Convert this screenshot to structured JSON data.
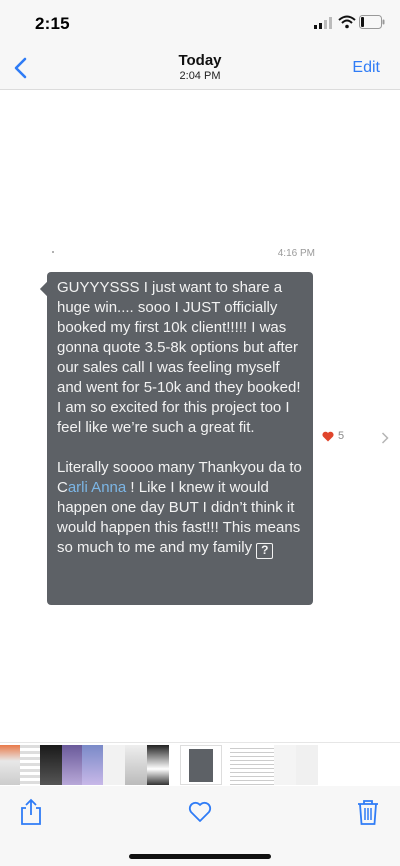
{
  "status_bar": {
    "time": "2:15"
  },
  "nav": {
    "title": "Today",
    "subtitle": "2:04 PM",
    "edit_label": "Edit"
  },
  "message": {
    "timestamp": "4:16 PM",
    "paragraph1": "GUYYYSSS I just want to share a huge win.... sooo I JUST officially booked my first 10k client!!!!! I was gonna quote 3.5-8k options but after our sales call I was feeling myself and went for 5-10k and they booked! I am so excited for this project too I feel like we’re such a great fit.",
    "paragraph2_start": "Literally soooo many Thankyou da to C",
    "mention": "arli Anna",
    "paragraph2_end": " ! Like I knew it would happen one day BUT I didn’t think it would happen this fast!!! This means so much to me and my family ",
    "qmark": "?",
    "reaction_count": "5"
  },
  "colors": {
    "accent": "#2f7cf6",
    "bubble": "#5d6166",
    "mention": "#7cb6e6",
    "heart": "#e0452c"
  },
  "icons": [
    "back-chevron-icon",
    "share-icon",
    "heart-icon",
    "trash-icon",
    "chevron-right-icon"
  ]
}
